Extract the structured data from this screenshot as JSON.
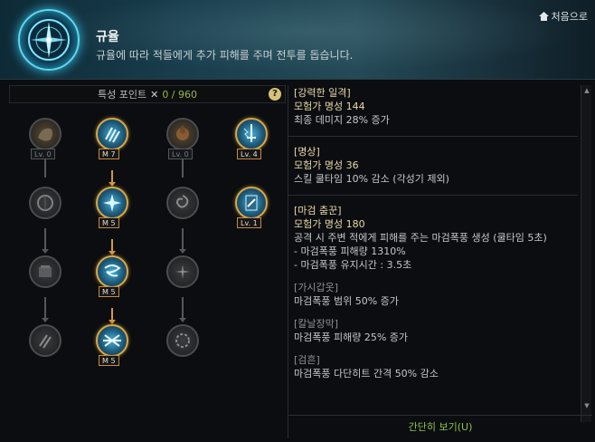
{
  "header": {
    "title": "규율",
    "description": "규율에 따라 적들에게 추가 피해를 주며 전투를 돕습니다.",
    "home_label": "처음으로"
  },
  "points": {
    "label": "특성 포인트",
    "value": "0 / 960",
    "help": "?"
  },
  "tree": {
    "levels": {
      "r1c1": "Lv. 0",
      "r1c2": "7",
      "r1c3": "Lv. 0",
      "r1c4": "Lv. 4",
      "r2c2": "5",
      "r2c4": "Lv. 1",
      "r3c2": "5",
      "r4c2": "5"
    },
    "m_badge": "M"
  },
  "details": {
    "s1": {
      "title": "[강력한 일격]",
      "req": "모험가 명성 144",
      "line1": "최종 데미지 28% 증가"
    },
    "s2": {
      "title": "[명상]",
      "req": "모험가 명성 36",
      "line1": "스킬 쿨타임 10% 감소 (각성기 제외)"
    },
    "s3": {
      "title": "[마검 춤꾼]",
      "req": "모험가 명성 180",
      "line1": "공격 시 주변 적에게 피해를 주는 마검폭풍 생성 (쿨타임 5초)",
      "line2": "- 마검폭풍 피해량 1310%",
      "line3": "- 마검폭풍 유지시간 : 3.5초",
      "sub1_title": "[가시갑옷]",
      "sub1_line": "마검폭풍 범위 50% 증가",
      "sub2_title": "[칼날장막]",
      "sub2_line": "마검폭풍 피해량 25% 증가",
      "sub3_title": "[검흔]",
      "sub3_line": "마검폭풍 다단히트 간격 50% 감소"
    }
  },
  "footer": {
    "toggle_label": "간단히 보기(U)"
  }
}
